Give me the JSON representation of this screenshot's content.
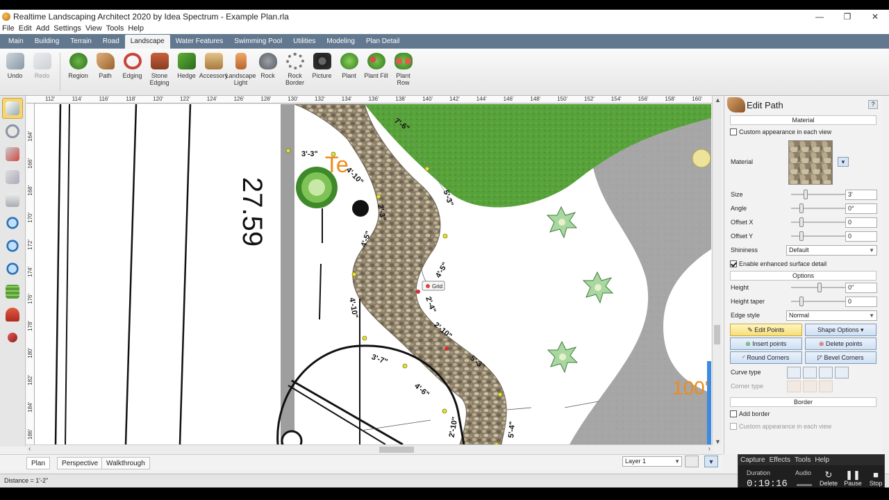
{
  "window": {
    "title": "Realtime Landscaping Architect 2020 by Idea Spectrum - Example Plan.rla",
    "controls": {
      "minimize": "—",
      "restore": "❐",
      "close": "✕"
    }
  },
  "menu": [
    "File",
    "Edit",
    "Add",
    "Settings",
    "View",
    "Tools",
    "Help"
  ],
  "tabs": [
    "Main",
    "Building",
    "Terrain",
    "Road",
    "Landscape",
    "Water Features",
    "Swimming Pool",
    "Utilities",
    "Modeling",
    "Plan Detail"
  ],
  "active_tab": "Landscape",
  "ribbon": {
    "undo": "Undo",
    "redo": "Redo",
    "tools": [
      "Region",
      "Path",
      "Edging",
      "Stone Edging",
      "Hedge",
      "Accessory",
      "Landscape Light",
      "Rock",
      "Rock Border",
      "Picture",
      "Plant",
      "Plant Fill",
      "Plant Row"
    ]
  },
  "rulers": {
    "horizontal": [
      "112'",
      "114'",
      "116'",
      "118'",
      "120'",
      "122'",
      "124'",
      "126'",
      "128'",
      "130'",
      "132'",
      "134'",
      "136'",
      "138'",
      "140'",
      "142'",
      "144'",
      "146'",
      "148'",
      "150'",
      "152'",
      "154'",
      "156'",
      "158'",
      "160'"
    ],
    "vertical": [
      "164'",
      "166'",
      "168'",
      "170'",
      "172'",
      "174'",
      "176'",
      "178'",
      "180'",
      "182'",
      "184'",
      "186'"
    ]
  },
  "canvas": {
    "dimension_labels": [
      "3'-3\"",
      "4'-10\"",
      "2'-3\"",
      "4'-5\"",
      "4'-10\"",
      "7'-6\"",
      "5'-3\"",
      "4'-5\"",
      "2'-4\"",
      "2'-10\"",
      "5'-3\"",
      "3'-7\"",
      "4'-6\"",
      "2'-10\"",
      "5'-4\""
    ],
    "grid_tooltip": "Grid",
    "partial_text_left": "27.59",
    "partial_text_orange": "Te",
    "partial_text_right": "100'",
    "colors": {
      "grass": "#5aa33c",
      "gravel": "#9c8e76",
      "road": "#a9a9a9",
      "selection": "#3b8be0"
    }
  },
  "view_tabs": [
    "Plan",
    "Perspective",
    "Walkthrough"
  ],
  "layer": {
    "selected": "Layer 1"
  },
  "status": "Distance = 1'-2\"",
  "panel": {
    "title": "Edit Path",
    "help": "?",
    "material_section": "Material",
    "custom_appearance": "Custom appearance in each view",
    "material_label": "Material",
    "size": {
      "label": "Size",
      "value": "3'"
    },
    "angle": {
      "label": "Angle",
      "value": "0°"
    },
    "offset_x": {
      "label": "Offset X",
      "value": "0"
    },
    "offset_y": {
      "label": "Offset Y",
      "value": "0"
    },
    "shininess": {
      "label": "Shininess",
      "value": "Default"
    },
    "enhanced": "Enable enhanced surface detail",
    "options_section": "Options",
    "height": {
      "label": "Height",
      "value": "0\""
    },
    "height_taper": {
      "label": "Height taper",
      "value": "0"
    },
    "edge_style": {
      "label": "Edge style",
      "value": "Normal"
    },
    "buttons": {
      "edit_points": "Edit Points",
      "shape_options": "Shape Options",
      "insert_points": "Insert points",
      "delete_points": "Delete points",
      "round_corners": "Round Corners",
      "bevel_corners": "Bevel Corners"
    },
    "curve_type": "Curve type",
    "corner_type": "Corner type",
    "border_section": "Border",
    "add_border": "Add border",
    "custom_appearance_2": "Custom appearance in each view"
  },
  "capture": {
    "menu": [
      "Capture",
      "Effects",
      "Tools",
      "Help"
    ],
    "duration_label": "Duration",
    "duration_value": "0:19:16",
    "audio_label": "Audio",
    "delete": "Delete",
    "pause": "Pause",
    "stop": "Stop"
  }
}
